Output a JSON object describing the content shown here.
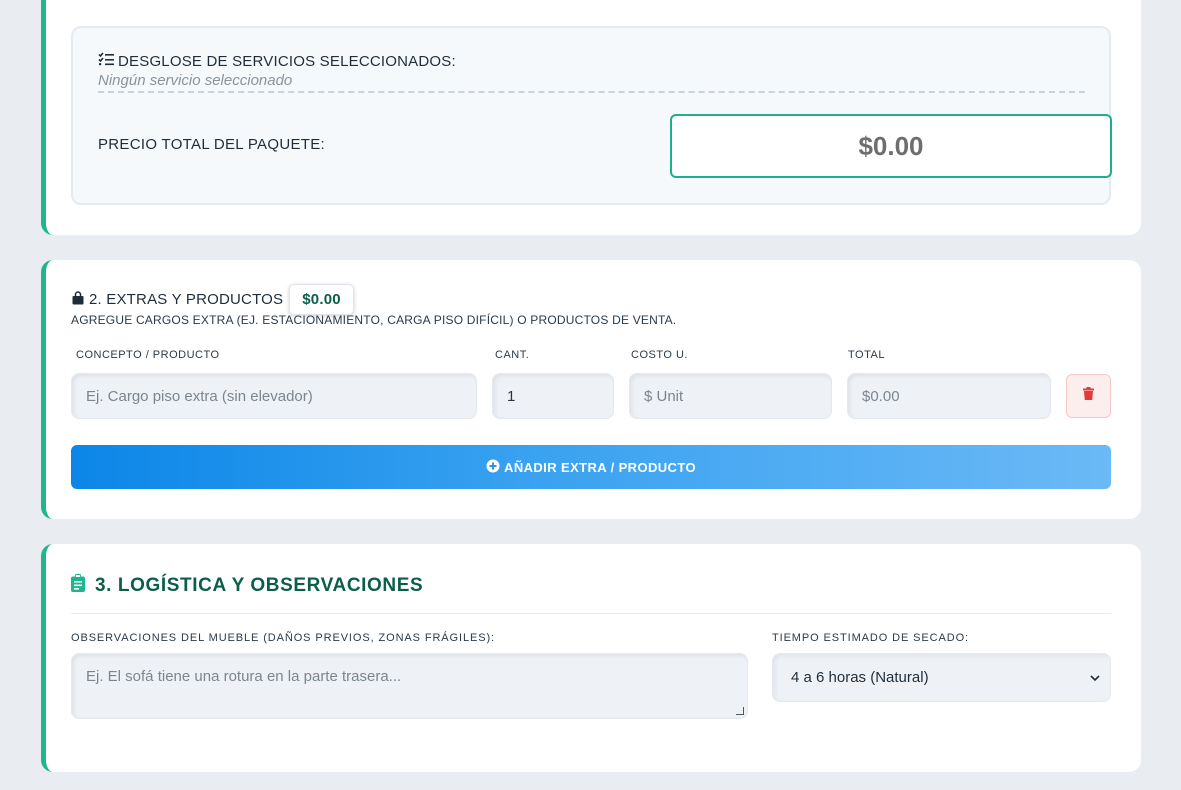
{
  "packageSummary": {
    "breakdownTitle": "DESGLOSE DE SERVICIOS SELECCIONADOS:",
    "breakdownEmpty": "Ningún servicio seleccionado",
    "totalLabel": "PRECIO TOTAL DEL PAQUETE:",
    "totalValue": "$0.00",
    "icons": {
      "breakdown": "list-check-icon"
    }
  },
  "extras": {
    "title": "2. EXTRAS Y PRODUCTOS",
    "badge": "$0.00",
    "subtitle": "AGREGUE CARGOS EXTRA (EJ. ESTACIONAMIENTO, CARGA PISO DIFÍCIL) O PRODUCTOS DE VENTA.",
    "columns": {
      "concept": "CONCEPTO / PRODUCTO",
      "qty": "CANT.",
      "unitCost": "COSTO U.",
      "total": "TOTAL"
    },
    "row": {
      "conceptPlaceholder": "Ej. Cargo piso extra (sin elevador)",
      "qtyValue": "1",
      "unitCostPlaceholder": "$ Unit",
      "totalValue": "$0.00"
    },
    "addButton": "AÑADIR EXTRA / PRODUCTO",
    "icons": {
      "title": "shopping-bag-icon",
      "delete": "trash-icon",
      "add": "plus-circle-icon"
    },
    "colors": {
      "accent": "#1fb58f",
      "badgeText": "#0b5e4a",
      "delete": "#e53935"
    }
  },
  "logistics": {
    "title": "3. LOGÍSTICA Y OBSERVACIONES",
    "observationsLabel": "OBSERVACIONES DEL MUEBLE (DAÑOS PREVIOS, ZONAS FRÁGILES):",
    "observationsPlaceholder": "Ej. El sofá tiene una rotura en la parte trasera...",
    "dryingLabel": "TIEMPO ESTIMADO DE SECADO:",
    "dryingSelected": "4 a 6 horas (Natural)",
    "icons": {
      "title": "clipboard-icon",
      "select": "chevron-down-icon"
    },
    "colors": {
      "title": "#0b5e4a",
      "icon": "#1fb58f"
    }
  }
}
